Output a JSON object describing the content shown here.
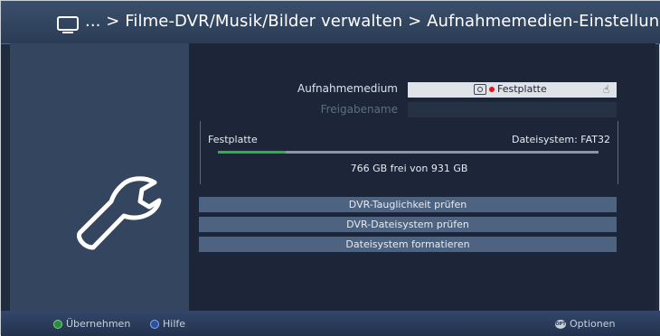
{
  "header": {
    "breadcrumb": "... > Filme-DVR/Musik/Bilder verwalten > Aufnahmemedien-Einstellungen"
  },
  "settings": {
    "medium_label": "Aufnahmemedium",
    "medium_value": "Festplatte",
    "share_label": "Freigabename",
    "share_value": ""
  },
  "disk": {
    "name": "Festplatte",
    "filesystem": "Dateisystem: FAT32",
    "free_text": "766 GB frei von 931 GB",
    "used_fraction": 0.177
  },
  "actions": [
    {
      "label": "DVR-Tauglichkeit prüfen"
    },
    {
      "label": "DVR-Dateisystem prüfen"
    },
    {
      "label": "Dateisystem formatieren"
    }
  ],
  "footer": {
    "green_label": "Übernehmen",
    "blue_label": "Hilfe",
    "options_key": "OPT",
    "options_label": "Optionen"
  },
  "colors": {
    "background": "#1f2b3e",
    "panel": "#34455f",
    "progress": "#2fb14a",
    "record_dot": "#e0161c"
  },
  "icons": [
    "tv-icon",
    "wrench-icon",
    "hdd-icon",
    "record-dot-icon",
    "hand-icon",
    "green-button-icon",
    "blue-button-icon",
    "options-button-icon"
  ]
}
